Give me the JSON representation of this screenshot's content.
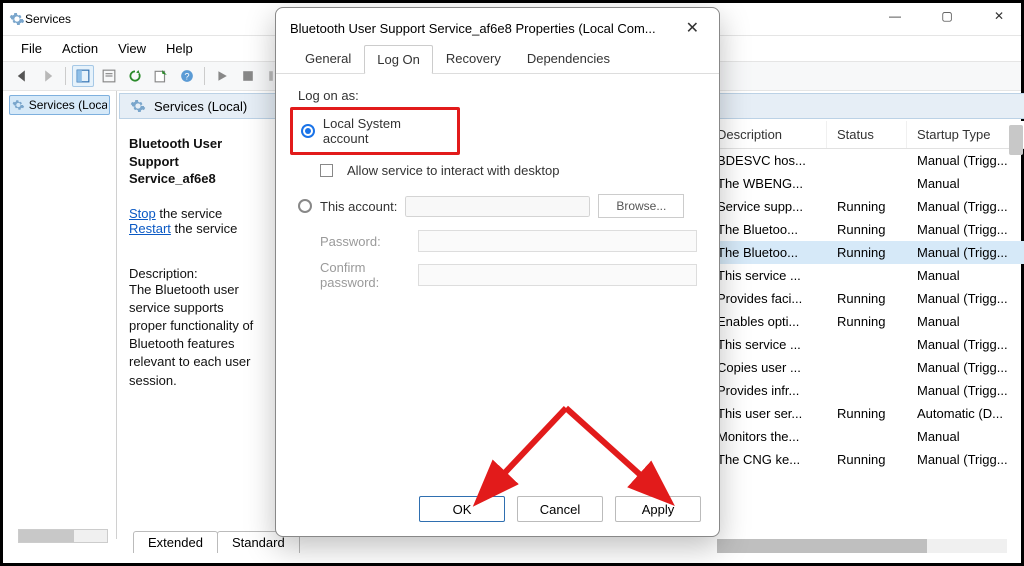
{
  "window": {
    "title": "Services",
    "menus": [
      "File",
      "Action",
      "View",
      "Help"
    ],
    "win_min": "—",
    "win_max": "▢",
    "win_close": "✕"
  },
  "tree": {
    "root": "Services (Local)"
  },
  "center_header": "Services (Local)",
  "detail": {
    "service_line1": "Bluetooth User Support",
    "service_line2": "Service_af6e8",
    "stop_link": "Stop",
    "stop_rest": " the service",
    "restart_link": "Restart",
    "restart_rest": " the service",
    "desc_label": "Description:",
    "desc_text": "The Bluetooth user service supports proper functionality of Bluetooth features relevant to each user session."
  },
  "grid": {
    "cols": {
      "description": "Description",
      "status": "Status",
      "startup": "Startup Type"
    },
    "rows": [
      {
        "desc": "BDESVC hos...",
        "status": "",
        "start": "Manual (Trigg..."
      },
      {
        "desc": "The WBENG...",
        "status": "",
        "start": "Manual"
      },
      {
        "desc": "Service supp...",
        "status": "Running",
        "start": "Manual (Trigg..."
      },
      {
        "desc": "The Bluetoo...",
        "status": "Running",
        "start": "Manual (Trigg..."
      },
      {
        "desc": "The Bluetoo...",
        "status": "Running",
        "start": "Manual (Trigg...",
        "selected": true
      },
      {
        "desc": "This service ...",
        "status": "",
        "start": "Manual"
      },
      {
        "desc": "Provides faci...",
        "status": "Running",
        "start": "Manual (Trigg..."
      },
      {
        "desc": "Enables opti...",
        "status": "Running",
        "start": "Manual"
      },
      {
        "desc": "This service ...",
        "status": "",
        "start": "Manual (Trigg..."
      },
      {
        "desc": "Copies user ...",
        "status": "",
        "start": "Manual (Trigg..."
      },
      {
        "desc": "Provides infr...",
        "status": "",
        "start": "Manual (Trigg..."
      },
      {
        "desc": "This user ser...",
        "status": "Running",
        "start": "Automatic (D..."
      },
      {
        "desc": "Monitors the...",
        "status": "",
        "start": "Manual"
      },
      {
        "desc": "The CNG ke...",
        "status": "Running",
        "start": "Manual (Trigg..."
      }
    ]
  },
  "bottom_tabs": {
    "extended": "Extended",
    "standard": "Standard"
  },
  "dialog": {
    "title": "Bluetooth User Support Service_af6e8 Properties (Local Com...",
    "tabs": {
      "general": "General",
      "logon": "Log On",
      "recovery": "Recovery",
      "dependencies": "Dependencies"
    },
    "logon": {
      "heading": "Log on as:",
      "local_system": "Local System account",
      "allow_interact": "Allow service to interact with desktop",
      "this_account": "This account:",
      "browse": "Browse...",
      "password": "Password:",
      "confirm": "Confirm password:"
    },
    "buttons": {
      "ok": "OK",
      "cancel": "Cancel",
      "apply": "Apply"
    }
  }
}
